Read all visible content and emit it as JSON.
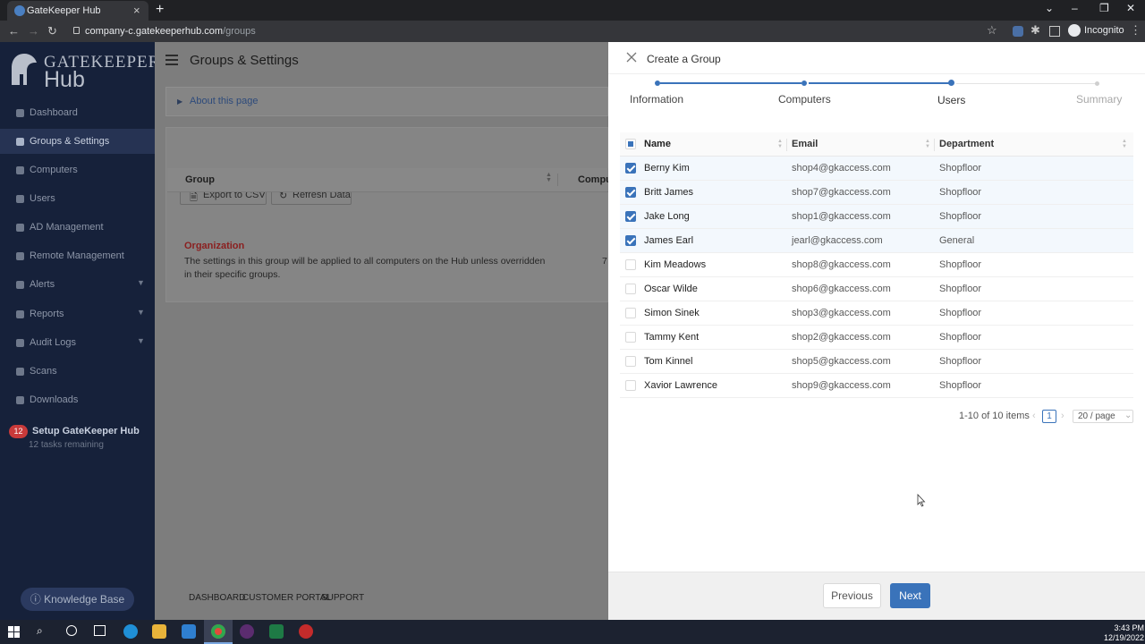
{
  "browser": {
    "tab_title": "GateKeeper Hub",
    "url_host": "company-c.gatekeeperhub.com",
    "url_path": "/groups",
    "profile_label": "Incognito"
  },
  "sidebar": {
    "logo_line1": "GATEKEEPER",
    "logo_line2": "Hub",
    "items": [
      {
        "label": "Dashboard",
        "icon": "dashboard-icon"
      },
      {
        "label": "Groups & Settings",
        "icon": "groups-icon",
        "active": true
      },
      {
        "label": "Computers",
        "icon": "computer-icon"
      },
      {
        "label": "Users",
        "icon": "users-icon"
      },
      {
        "label": "AD Management",
        "icon": "ad-icon"
      },
      {
        "label": "Remote Management",
        "icon": "remote-icon"
      },
      {
        "label": "Alerts",
        "icon": "bell-icon",
        "expandable": true
      },
      {
        "label": "Reports",
        "icon": "report-icon",
        "expandable": true
      },
      {
        "label": "Audit Logs",
        "icon": "audit-icon",
        "expandable": true
      },
      {
        "label": "Scans",
        "icon": "wifi-icon"
      },
      {
        "label": "Downloads",
        "icon": "download-icon"
      }
    ],
    "setup_badge": "12",
    "setup_title": "Setup GateKeeper Hub",
    "setup_sub": "12 tasks remaining",
    "knowledge_base": "Knowledge Base"
  },
  "main": {
    "page_title": "Groups & Settings",
    "about_label": "About this page",
    "export_label": "Export to CSV",
    "refresh_label": "Refresh Data",
    "col_group": "Group",
    "col_computers": "Compute",
    "org_name": "Organization",
    "org_desc": "The settings in this group will be applied to all computers on the Hub unless overridden in their specific groups.",
    "org_count": "7",
    "footer_links": [
      "DASHBOARD",
      "CUSTOMER PORTAL",
      "SUPPORT"
    ]
  },
  "drawer": {
    "title": "Create a Group",
    "steps": [
      "Information",
      "Computers",
      "Users",
      "Summary"
    ],
    "current_step": 2,
    "columns": {
      "name": "Name",
      "email": "Email",
      "department": "Department"
    },
    "rows": [
      {
        "name": "Berny Kim",
        "email": "shop4@gkaccess.com",
        "department": "Shopfloor",
        "selected": true
      },
      {
        "name": "Britt James",
        "email": "shop7@gkaccess.com",
        "department": "Shopfloor",
        "selected": true
      },
      {
        "name": "Jake Long",
        "email": "shop1@gkaccess.com",
        "department": "Shopfloor",
        "selected": true
      },
      {
        "name": "James Earl",
        "email": "jearl@gkaccess.com",
        "department": "General",
        "selected": true
      },
      {
        "name": "Kim Meadows",
        "email": "shop8@gkaccess.com",
        "department": "Shopfloor",
        "selected": false
      },
      {
        "name": "Oscar Wilde",
        "email": "shop6@gkaccess.com",
        "department": "Shopfloor",
        "selected": false
      },
      {
        "name": "Simon Sinek",
        "email": "shop3@gkaccess.com",
        "department": "Shopfloor",
        "selected": false
      },
      {
        "name": "Tammy Kent",
        "email": "shop2@gkaccess.com",
        "department": "Shopfloor",
        "selected": false
      },
      {
        "name": "Tom Kinnel",
        "email": "shop5@gkaccess.com",
        "department": "Shopfloor",
        "selected": false
      },
      {
        "name": "Xavior Lawrence",
        "email": "shop9@gkaccess.com",
        "department": "Shopfloor",
        "selected": false
      }
    ],
    "pagination_summary": "1-10 of 10 items",
    "current_page": "1",
    "page_size": "20 / page",
    "prev_label": "Previous",
    "next_label": "Next"
  },
  "taskbar": {
    "time": "3:43 PM",
    "date": "12/19/2022"
  },
  "colors": {
    "accent": "#3a73ba",
    "sidebar_bg": "#16213a",
    "badge_red": "#c83a3a"
  }
}
